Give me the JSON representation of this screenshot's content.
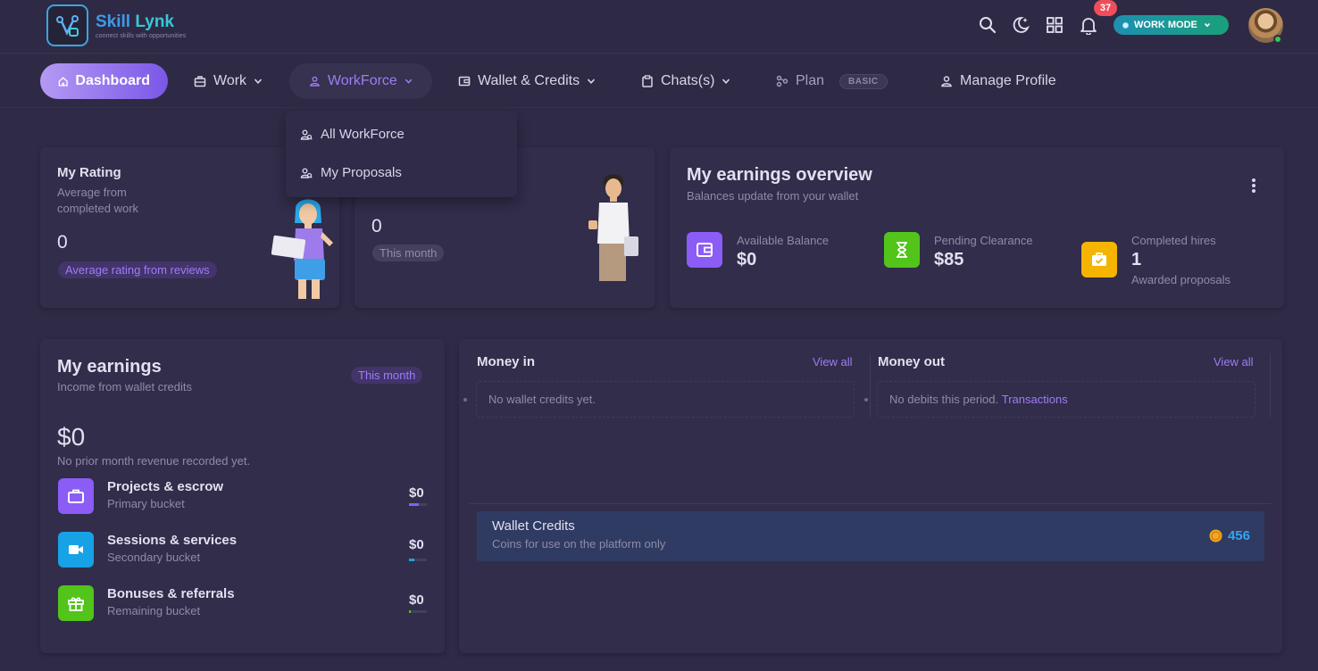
{
  "brand": {
    "name_part1": "Skill",
    "name_part2": "Lynk",
    "tagline": "connect skills with opportunities"
  },
  "topbar": {
    "icons": [
      "search-icon",
      "theme-toggle-icon",
      "apps-grid-icon",
      "bell-icon"
    ],
    "notification_count": "37",
    "work_mode_label": "WORK MODE"
  },
  "nav": {
    "dashboard": "Dashboard",
    "work": "Work",
    "workforce": "WorkForce",
    "wallet": "Wallet & Credits",
    "chats": "Chats(s)",
    "plan": "Plan",
    "plan_badge": "BASIC",
    "profile": "Manage Profile"
  },
  "workforce_menu": {
    "items": [
      "All WorkForce",
      "My Proposals"
    ]
  },
  "rating_card": {
    "title": "My Rating",
    "subtitle_line1": "Average from",
    "subtitle_line2": "completed work",
    "value": "0",
    "pill": "Average rating from reviews"
  },
  "second_card": {
    "value": "0",
    "pill": "This month"
  },
  "overview": {
    "title": "My earnings overview",
    "subtitle": "Balances update from your wallet",
    "available_label": "Available Balance",
    "available_value": "$0",
    "pending_label": "Pending Clearance",
    "pending_value": "$85",
    "hires_label": "Completed hires",
    "hires_value": "1",
    "hires_sub": "Awarded proposals",
    "colors": {
      "available": "#8b5cf6",
      "pending": "#52c41a",
      "hires": "#f5b400"
    }
  },
  "earnings": {
    "title": "My earnings",
    "subtitle": "Income from wallet credits",
    "period_pill": "This month",
    "total": "$0",
    "note": "No prior month revenue recorded yet.",
    "buckets": [
      {
        "name": "Projects & escrow",
        "sub": "Primary bucket",
        "value": "$0",
        "icon": "briefcase-icon",
        "color": "#8b5cf6",
        "fill": 0.55
      },
      {
        "name": "Sessions & services",
        "sub": "Secondary bucket",
        "value": "$0",
        "icon": "video-icon",
        "color": "#17a2e6",
        "fill": 0.3
      },
      {
        "name": "Bonuses & referrals",
        "sub": "Remaining bucket",
        "value": "$0",
        "icon": "gift-icon",
        "color": "#52c41a",
        "fill": 0.1
      }
    ]
  },
  "money": {
    "in_title": "Money in",
    "in_view_all": "View all",
    "in_empty": "No wallet credits yet.",
    "out_title": "Money out",
    "out_view_all": "View all",
    "out_empty": "No debits this period.",
    "out_link": "Transactions"
  },
  "wallet_credits": {
    "title": "Wallet Credits",
    "subtitle": "Coins for use on the platform only",
    "amount": "456"
  }
}
